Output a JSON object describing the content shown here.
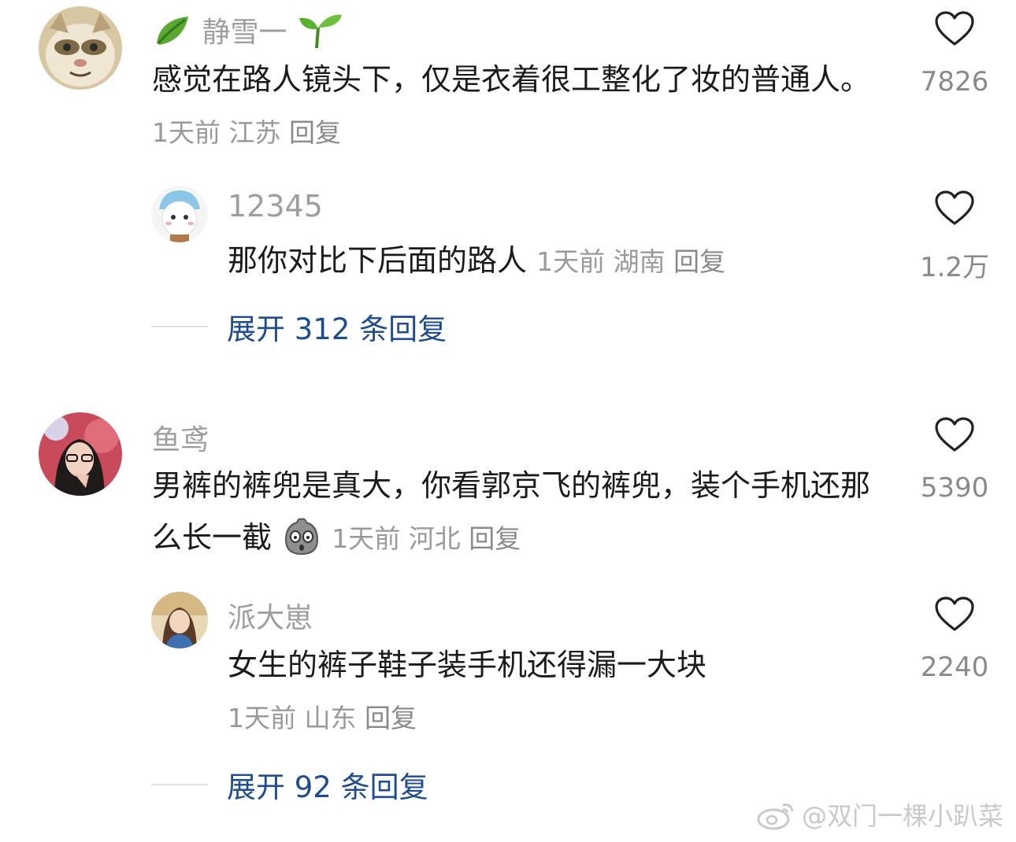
{
  "comments": [
    {
      "username": "静雪一",
      "text": "感觉在路人镜头下，仅是衣着很工整化了妆的普通人。",
      "time": "1天前",
      "location": "江苏",
      "reply": "回复",
      "likes": "7826",
      "replies": [
        {
          "username": "12345",
          "text": "那你对比下后面的路人",
          "time": "1天前",
          "location": "湖南",
          "reply": "回复",
          "likes": "1.2万"
        }
      ],
      "expand_label": "展开 312 条回复"
    },
    {
      "username": "鱼鸢",
      "text": "男裤的裤兜是真大，你看郭京飞的裤兜，装个手机还那么长一截",
      "time": "1天前",
      "location": "河北",
      "reply": "回复",
      "likes": "5390",
      "replies": [
        {
          "username": "派大崽",
          "text": "女生的裤子鞋子装手机还得漏一大块",
          "time": "1天前",
          "location": "山东",
          "reply": "回复",
          "likes": "2240"
        }
      ],
      "expand_label": "展开 92 条回复"
    }
  ],
  "watermark": "@双门一棵小趴菜",
  "icons": {
    "like": "heart-outline-icon",
    "badge_left": "leaf-emoji",
    "badge_right": "seedling-emoji",
    "inline_emoji": "shocked-potato-emoji",
    "watermark": "weibo-logo-icon"
  },
  "colors": {
    "username": "#9e9e9e",
    "expand_link": "#1e4c8f",
    "meta": "#9a9a9a"
  }
}
